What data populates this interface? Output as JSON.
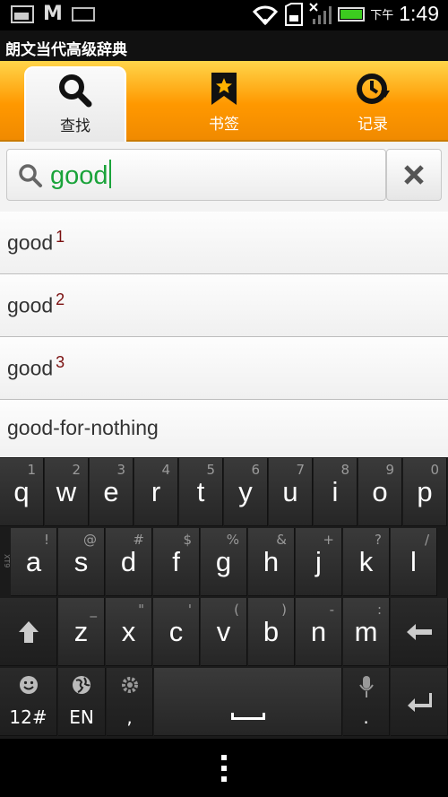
{
  "status": {
    "ampm": "下午",
    "time": "1:49"
  },
  "app": {
    "title": "朗文当代高级辞典"
  },
  "tabs": [
    {
      "label": "查找",
      "icon": "search-icon",
      "active": true
    },
    {
      "label": "书签",
      "icon": "bookmark-icon",
      "active": false
    },
    {
      "label": "记录",
      "icon": "history-icon",
      "active": false
    }
  ],
  "search": {
    "value": "good"
  },
  "results": [
    {
      "word": "good",
      "sup": "1"
    },
    {
      "word": "good",
      "sup": "2"
    },
    {
      "word": "good",
      "sup": "3"
    },
    {
      "word": "good-for-nothing",
      "sup": ""
    }
  ],
  "keyboard": {
    "row1": [
      [
        "q",
        "1"
      ],
      [
        "w",
        "2"
      ],
      [
        "e",
        "3"
      ],
      [
        "r",
        "4"
      ],
      [
        "t",
        "5"
      ],
      [
        "y",
        "6"
      ],
      [
        "u",
        "7"
      ],
      [
        "i",
        "8"
      ],
      [
        "o",
        "9"
      ],
      [
        "p",
        "0"
      ]
    ],
    "row2": [
      [
        "a",
        "!"
      ],
      [
        "s",
        "@"
      ],
      [
        "d",
        "#"
      ],
      [
        "f",
        "$"
      ],
      [
        "g",
        "%"
      ],
      [
        "h",
        "&"
      ],
      [
        "j",
        "+"
      ],
      [
        "k",
        "?"
      ],
      [
        "l",
        "/"
      ]
    ],
    "row3": [
      [
        "z",
        "_"
      ],
      [
        "x",
        "\""
      ],
      [
        "c",
        "'"
      ],
      [
        "v",
        "("
      ],
      [
        "b",
        ")"
      ],
      [
        "n",
        "-"
      ],
      [
        "m",
        ":"
      ]
    ],
    "side_label": "XT9",
    "sym_label": "12#",
    "lang_label": "EN",
    "comma": ",",
    "period": "."
  },
  "colors": {
    "accent": "#ff9800",
    "input_text": "#1aa33a",
    "superscript": "#7a1010"
  }
}
